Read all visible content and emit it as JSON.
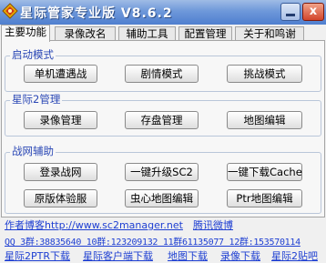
{
  "window": {
    "title": "星际管家专业版 V8.6.2",
    "close_label": "x"
  },
  "tabs": [
    {
      "label": "主要功能",
      "active": true
    },
    {
      "label": "录像改名",
      "active": false
    },
    {
      "label": "辅助工具",
      "active": false
    },
    {
      "label": "配置管理",
      "active": false
    },
    {
      "label": "关于和鸣谢",
      "active": false
    }
  ],
  "groups": {
    "launch": {
      "title": "启动模式",
      "buttons": [
        "单机遭遇战",
        "剧情模式",
        "挑战模式"
      ]
    },
    "sc2": {
      "title": "星际2管理",
      "buttons": [
        "录像管理",
        "存盘管理",
        "地图编辑"
      ]
    },
    "battlenet": {
      "title": "战网辅助",
      "buttons": [
        "登录战网",
        "一键升级SC2",
        "一键下载Cache",
        "原版体验服",
        "虫心地图编辑",
        "Ptr地图编辑"
      ]
    }
  },
  "footer": {
    "blog_label": "作者博客",
    "blog_url": "http://www.sc2manager.net",
    "weibo_label": "腾讯微博",
    "qq_groups": "QQ 3群:38835640 10群:123209132 11群61135077 12群:153570114",
    "bottom_links": [
      "星际2PTR下载",
      "星际客户端下载",
      "地图下载",
      "录像下载",
      "星际2贴吧"
    ]
  },
  "colors": {
    "title_gradient_top": "#9fbbe5",
    "title_gradient_bottom": "#4f7fcf",
    "group_title": "#2a47b5",
    "link": "#1e3fd2"
  }
}
